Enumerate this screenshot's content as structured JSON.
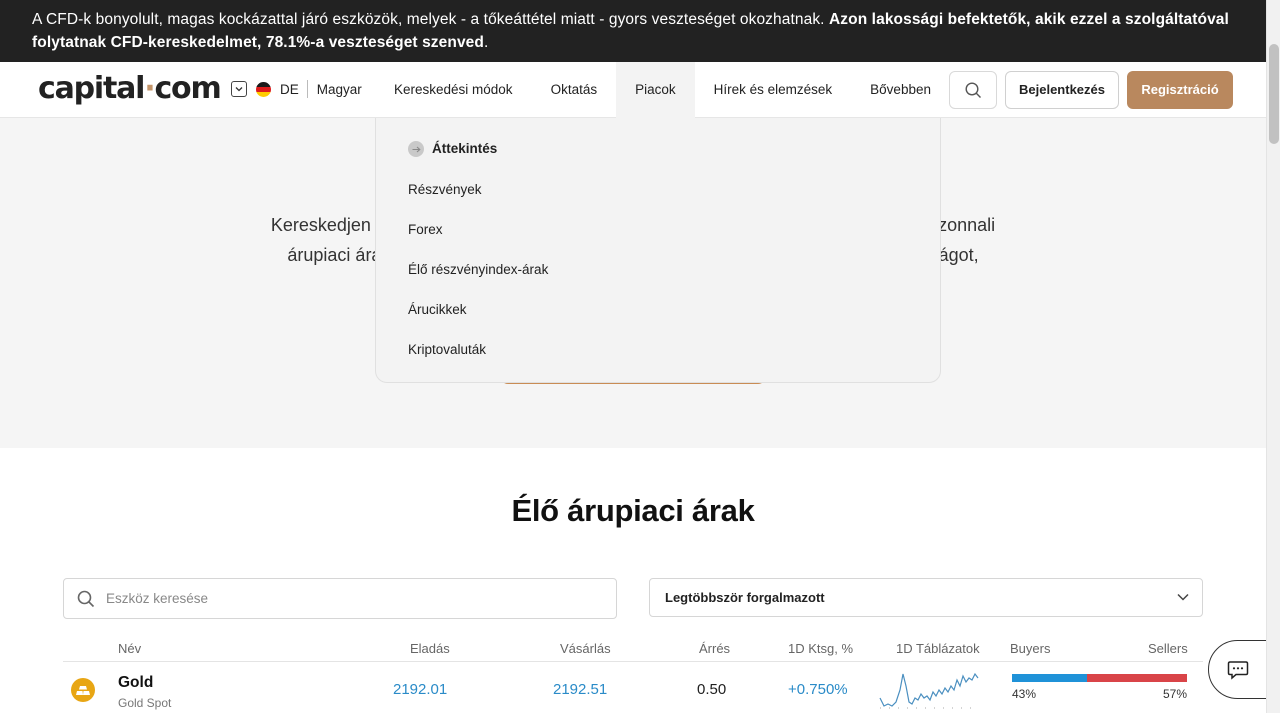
{
  "warning": {
    "text_regular": "A CFD-k bonyolult, magas kockázattal járó eszközök, melyek - a tőkeáttétel miatt - gyors veszteséget okozhatnak.",
    "text_bold": "Azon lakossági befektetők, akik ezzel a szolgáltatóval folytatnak CFD-kereskedelmet, 78.1%-a veszteséget szenved",
    "text_end": "."
  },
  "header": {
    "logo_main": "capital",
    "logo_dot": "·",
    "logo_end": "com",
    "country_code": "DE",
    "language": "Magyar",
    "nav": [
      {
        "label": "Kereskedési módok"
      },
      {
        "label": "Oktatás"
      },
      {
        "label": "Piacok"
      },
      {
        "label": "Hírek és elemzések"
      },
      {
        "label": "Bővebben"
      }
    ],
    "login_label": "Bejelentkezés",
    "register_label": "Regisztráció"
  },
  "hero": {
    "line1": "Kereskedjen az ege                                                                                             ztül azonnali",
    "line2": "árupiaci árak érhe                                                                                          almasságot,"
  },
  "dropdown": {
    "items": [
      {
        "label": "Áttekintés"
      },
      {
        "label": "Részvények"
      },
      {
        "label": "Forex"
      },
      {
        "label": "Élő részvényindex-árak"
      },
      {
        "label": "Árucikkek"
      },
      {
        "label": "Kriptovaluták"
      }
    ]
  },
  "main": {
    "title": "Élő árupiaci árak",
    "search_placeholder": "Eszköz keresése",
    "filter_selected": "Legtöbbször forgalmazott",
    "columns": {
      "name": "Név",
      "sell": "Eladás",
      "buy": "Vásárlás",
      "spread": "Árrés",
      "change": "1D Ktsg, %",
      "charts": "1D Táblázatok",
      "buyers": "Buyers",
      "sellers": "Sellers"
    },
    "rows": [
      {
        "name": "Gold",
        "sub": "Gold Spot",
        "sell": "2192.01",
        "buy": "2192.51",
        "spread": "0.50",
        "change": "+0.750%",
        "buyers_pct": "43%",
        "sellers_pct": "57%",
        "buyers_fraction": 0.43
      }
    ]
  },
  "colors": {
    "brand": "#b9885e",
    "positive": "#2a8bc8",
    "buyers": "#1f92d8",
    "sellers": "#d94448"
  }
}
